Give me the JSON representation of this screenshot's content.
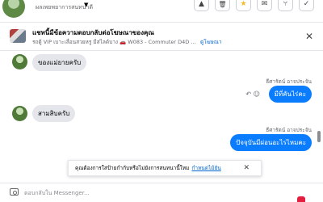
{
  "header": {
    "subtitle": "ผลเพยพยาการสนทนาดี",
    "chevron": "▼",
    "buttons": [
      {
        "icon": "warning-icon",
        "glyph": "▲"
      },
      {
        "icon": "trash-icon",
        "glyph": "🗑"
      },
      {
        "icon": "star-icon",
        "glyph": "★"
      },
      {
        "icon": "mail-icon",
        "glyph": "✉"
      },
      {
        "icon": "merge-icon",
        "glyph": "⑂"
      },
      {
        "icon": "check-icon",
        "glyph": "✓"
      }
    ]
  },
  "pinned": {
    "title": "แชทนี้มีข้อความตอบกลับต่อโฆษณาของคุณ",
    "description": "รถตู้ VIP เบาะเลื่อนสวยหรู มีสไลด์บาง 🚗 W083 - Commuter D4D 3...",
    "link": "ดูโฆษณา",
    "close": "✕"
  },
  "thread": {
    "messages": [
      {
        "direction": "in",
        "text": "ของแม่ยายครับ"
      },
      {
        "direction": "out",
        "sender": "ธีศารัตน์ อาจประจัน",
        "text": "มีที่คันไร่คะ"
      },
      {
        "direction": "in",
        "text": "สามสิบครับ"
      },
      {
        "direction": "out",
        "sender": "ธีศารัตน์ อาจประจัน",
        "text": "ปัจจุบันมีผ่อนอะไรไหมคะ"
      }
    ],
    "actions": "↶ ☺"
  },
  "toast": {
    "text": "คุณต้องการใส่ป้ายกำกับหรือไม่ยังการสนทนานี้ใหม",
    "link": "กำหนดไม้ยัน",
    "close": "✕"
  },
  "composer": {
    "placeholder": "ตอบกลับใน Messenger..."
  },
  "colors": {
    "accent_blue": "#0a7cff",
    "incoming_bubble": "#e4e6eb",
    "link": "#0064d1"
  }
}
